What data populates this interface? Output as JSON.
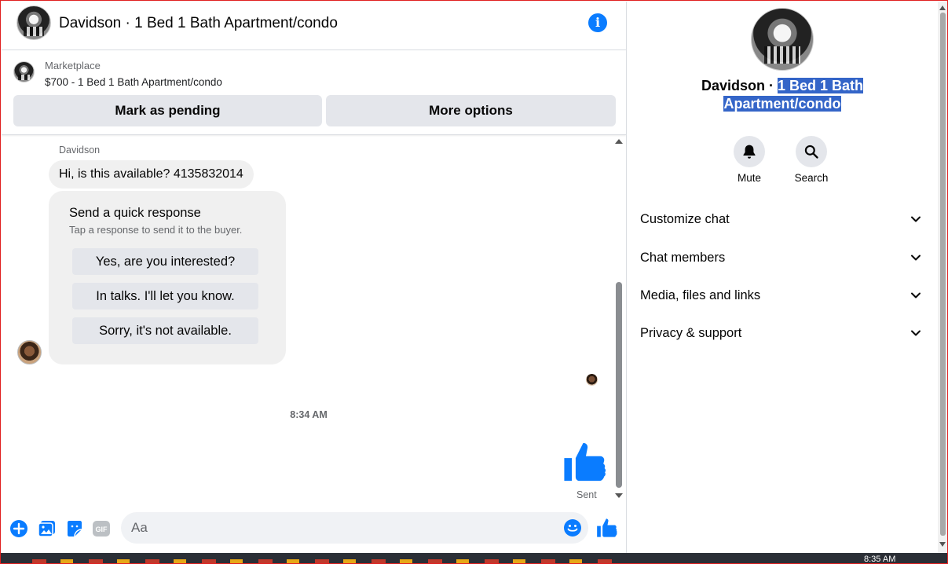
{
  "header": {
    "title": "Davidson · 1 Bed 1 Bath Apartment/condo"
  },
  "listing": {
    "source": "Marketplace",
    "price_title": "$700 - 1 Bed 1 Bath Apartment/condo",
    "mark_pending_label": "Mark as pending",
    "more_options_label": "More options"
  },
  "messages": {
    "sender_name": "Davidson",
    "first_message": "Hi, is this available? 4135832014",
    "quick_response": {
      "title": "Send a quick response",
      "subtitle": "Tap a response to send it to the buyer.",
      "options": [
        "Yes, are you interested?",
        "In talks. I'll let you know.",
        "Sorry, it's not available."
      ]
    },
    "timestamp": "8:34 AM",
    "sent_status": "Sent"
  },
  "composer": {
    "placeholder": "Aa"
  },
  "info_panel": {
    "name_plain": "Davidson · ",
    "name_highlight_line1": "1 Bed 1 Bath",
    "name_highlight_line2": "Apartment/condo",
    "mute_label": "Mute",
    "search_label": "Search",
    "sections": [
      "Customize chat",
      "Chat members",
      "Media, files and links",
      "Privacy & support"
    ]
  },
  "taskbar": {
    "clock": "8:35 AM"
  },
  "colors": {
    "accent": "#0a7cff",
    "selection": "#3465c8",
    "bubble": "#f0f0f0",
    "button": "#e4e6eb"
  }
}
